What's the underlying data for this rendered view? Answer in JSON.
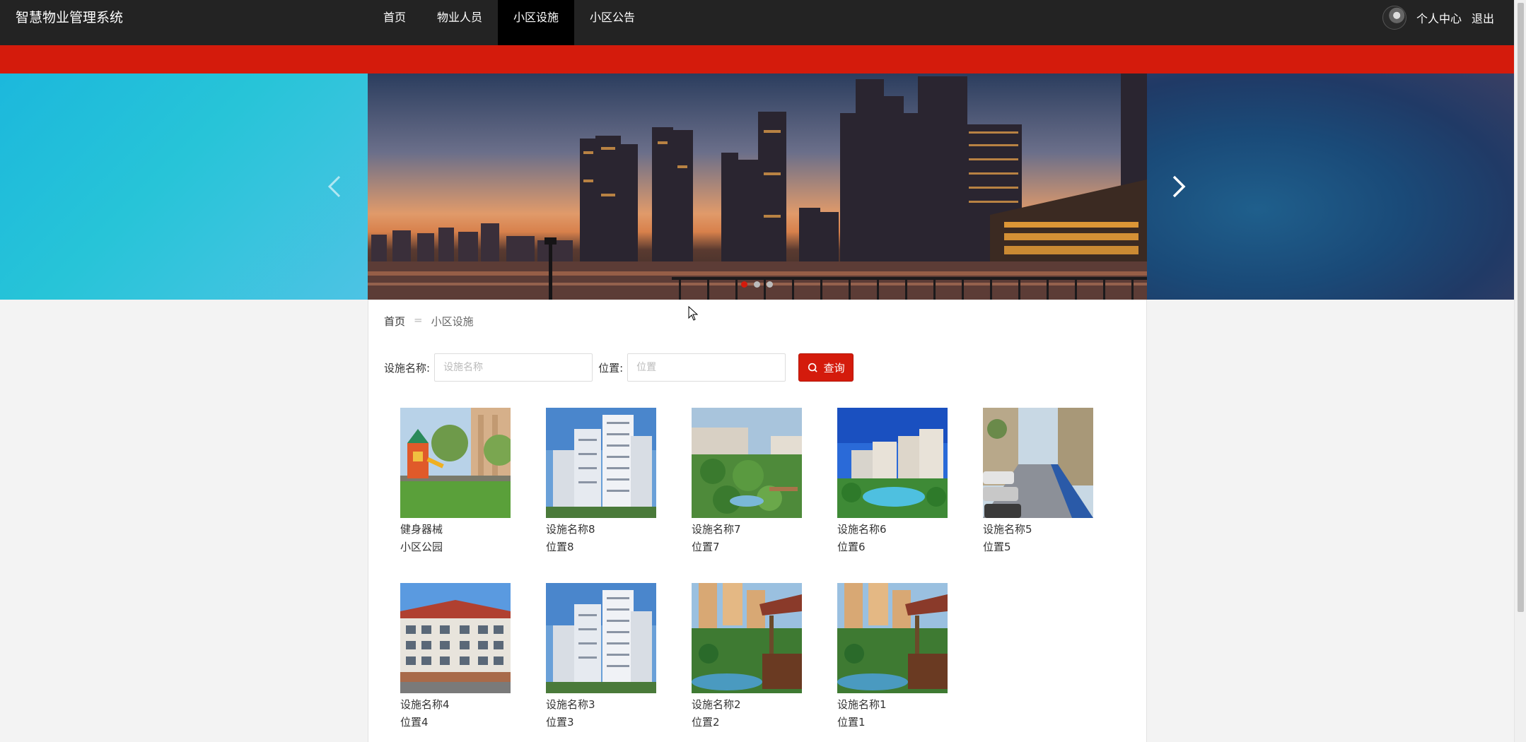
{
  "app": {
    "title": "智慧物业管理系统"
  },
  "nav": {
    "items": [
      {
        "label": "首页",
        "active": false
      },
      {
        "label": "物业人员",
        "active": false
      },
      {
        "label": "小区设施",
        "active": true
      },
      {
        "label": "小区公告",
        "active": false
      }
    ]
  },
  "user": {
    "center_label": "个人中心",
    "logout_label": "退出"
  },
  "carousel": {
    "slide_count": 3,
    "active_index": 0
  },
  "breadcrumb": {
    "home": "首页",
    "separator": "=",
    "current": "小区设施"
  },
  "search": {
    "name_label": "设施名称:",
    "name_placeholder": "设施名称",
    "name_value": "",
    "location_label": "位置:",
    "location_placeholder": "位置",
    "location_value": "",
    "button_label": "查询"
  },
  "facilities": [
    {
      "name": "健身器械",
      "location": "小区公园"
    },
    {
      "name": "设施名称8",
      "location": "位置8"
    },
    {
      "name": "设施名称7",
      "location": "位置7"
    },
    {
      "name": "设施名称6",
      "location": "位置6"
    },
    {
      "name": "设施名称5",
      "location": "位置5"
    },
    {
      "name": "设施名称4",
      "location": "位置4"
    },
    {
      "name": "设施名称3",
      "location": "位置3"
    },
    {
      "name": "设施名称2",
      "location": "位置2"
    },
    {
      "name": "设施名称1",
      "location": "位置1"
    }
  ],
  "colors": {
    "navbar": "#232323",
    "accent": "#d41b0c"
  }
}
